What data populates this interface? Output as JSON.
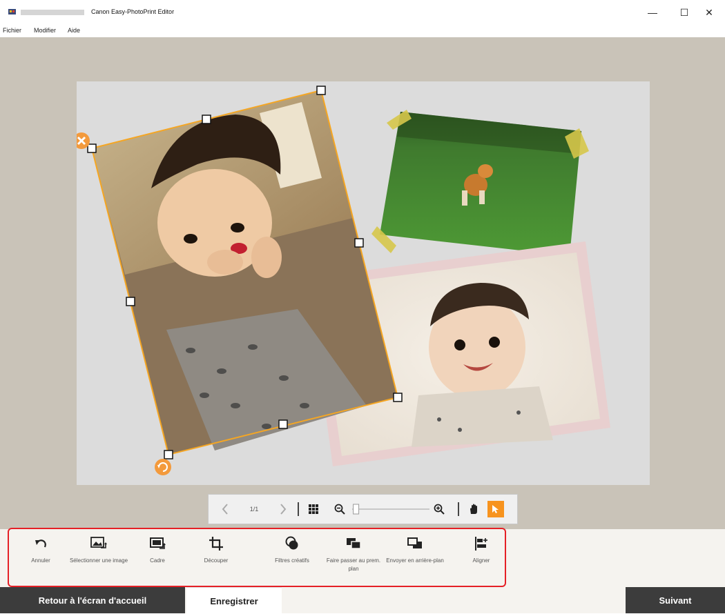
{
  "titlebar": {
    "app_title": "Canon Easy-PhotoPrint Editor",
    "minimize_label": "—",
    "maximize_label": "☐",
    "close_label": "✕"
  },
  "menu": [
    "Fichier",
    "Modifier",
    "Aide"
  ],
  "nav": {
    "page_indicator": "1/1",
    "prev_icon": "chevron-left-icon",
    "next_icon": "chevron-right-icon",
    "zoom": 0.05
  },
  "edit_tools": [
    {
      "label": "Annuler",
      "icon": "undo-icon"
    },
    {
      "label": "Sélectionner une image",
      "icon": "select-image-icon"
    },
    {
      "label": "Cadre",
      "icon": "frame-icon"
    },
    {
      "label": "Découper",
      "icon": "crop-icon"
    },
    {
      "label": "Filtres créatifs",
      "icon": "filters-icon"
    },
    {
      "label": "Faire passer au prem. plan",
      "icon": "bring-to-front-icon"
    },
    {
      "label": "Envoyer en arrière-plan",
      "icon": "send-to-back-icon"
    },
    {
      "label": "Aligner",
      "icon": "align-icon"
    }
  ],
  "bottom": {
    "home_label": "Retour à l'écran d'accueil",
    "save_label": "Enregistrer",
    "next_label": "Suivant"
  },
  "colors": {
    "selection": "#f5a623",
    "highlight": "#e51f26",
    "dark_button": "#3c3c3c",
    "workspace": "#c9c3b8",
    "canvas": "#dcdcdc"
  }
}
